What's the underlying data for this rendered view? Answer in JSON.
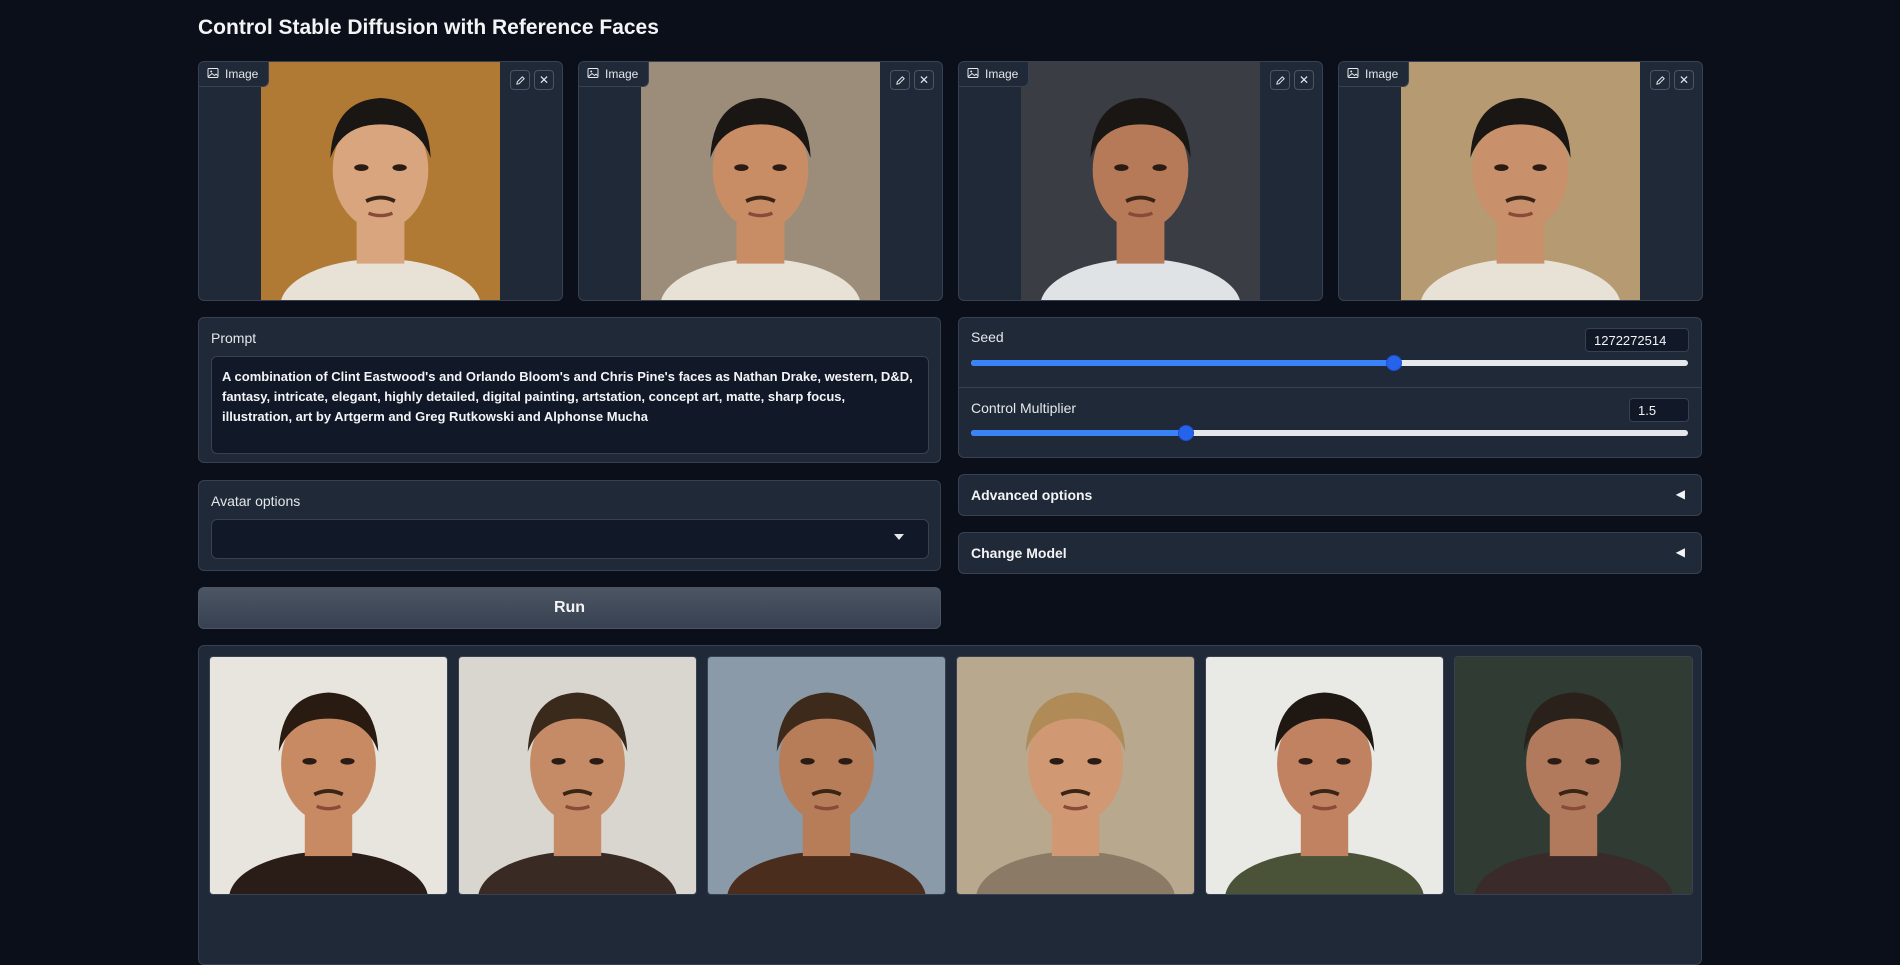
{
  "page": {
    "title": "Control Stable Diffusion with Reference Faces"
  },
  "reference_images": [
    {
      "label": "Image",
      "bg": "#b07a35"
    },
    {
      "label": "Image",
      "bg": "#9c8d7a"
    },
    {
      "label": "Image",
      "bg": "#3a3e44"
    },
    {
      "label": "Image",
      "bg": "#b59a72"
    }
  ],
  "prompt": {
    "label": "Prompt",
    "value": "A combination of Clint Eastwood's and Orlando Bloom's and Chris Pine's faces as Nathan Drake, western, D&D, fantasy, intricate, elegant, highly detailed, digital painting, artstation, concept art, matte, sharp focus, illustration, art by Artgerm and Greg Rutkowski and Alphonse Mucha"
  },
  "seed": {
    "label": "Seed",
    "value": "1272272514",
    "fraction": 0.59
  },
  "control_multiplier": {
    "label": "Control Multiplier",
    "value": "1.5",
    "fraction": 0.3
  },
  "advanced_options": {
    "label": "Advanced options",
    "arrow": "◀"
  },
  "change_model": {
    "label": "Change Model",
    "arrow": "◀"
  },
  "avatar_options": {
    "label": "Avatar options",
    "value": ""
  },
  "run": {
    "label": "Run"
  },
  "gallery": [
    {
      "name": "result-1",
      "bg": "#e8e4de"
    },
    {
      "name": "result-2",
      "bg": "#d9d6d0"
    },
    {
      "name": "result-3",
      "bg": "#8a9aa8"
    },
    {
      "name": "result-4",
      "bg": "#b8a88e"
    },
    {
      "name": "result-5",
      "bg": "#e9e9e6"
    },
    {
      "name": "result-6",
      "bg": "#2f3b33"
    }
  ],
  "colors": {
    "accent": "#3b82f6",
    "background": "#0b0f19",
    "panel": "#1f2937"
  }
}
